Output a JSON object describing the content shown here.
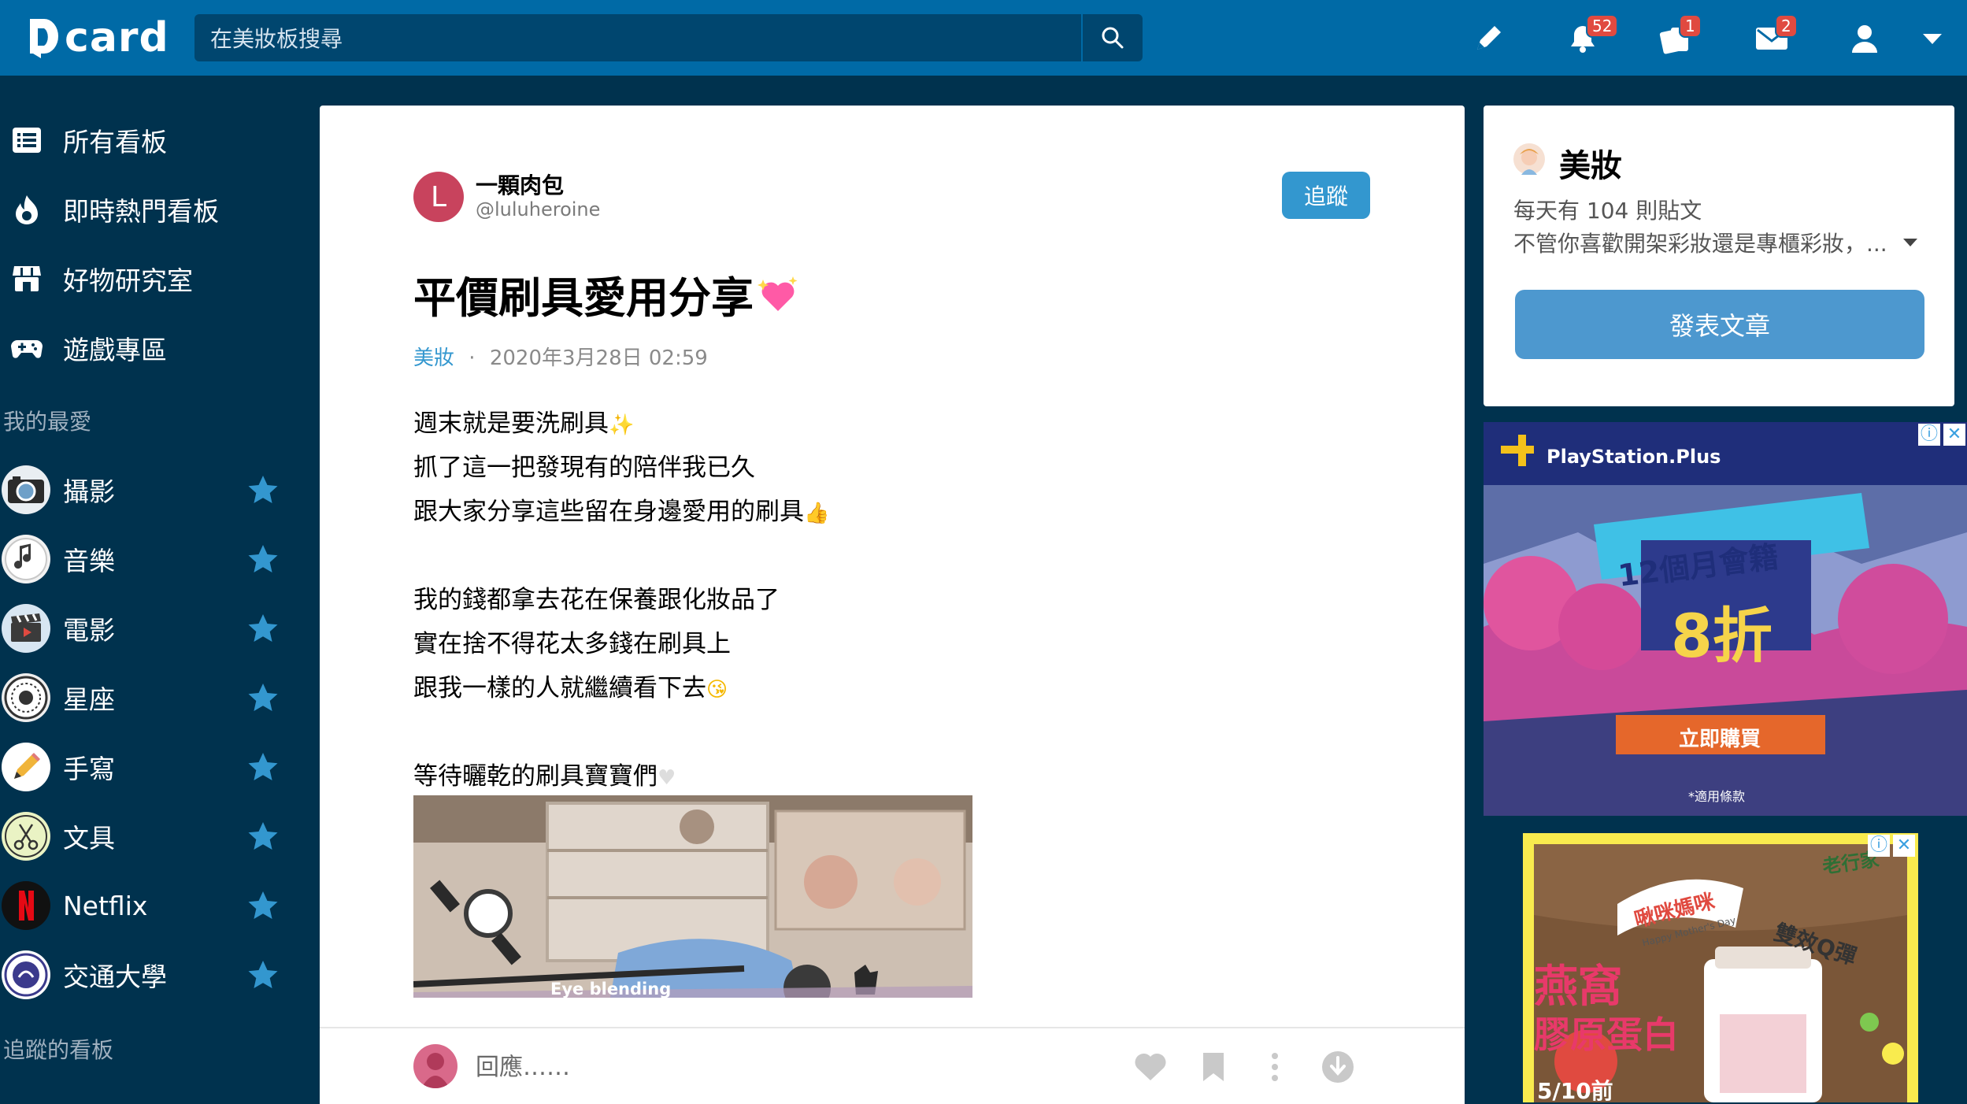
{
  "app": {
    "logo_text": "card"
  },
  "search": {
    "placeholder": "在美妝板搜尋"
  },
  "nav": {
    "notifications_count": "52",
    "cards_count": "1",
    "messages_count": "2"
  },
  "sidebar": {
    "main_items": [
      {
        "label": "所有看板",
        "icon": "list-icon"
      },
      {
        "label": "即時熱門看板",
        "icon": "flame-icon"
      },
      {
        "label": "好物研究室",
        "icon": "store-icon"
      },
      {
        "label": "遊戲專區",
        "icon": "gamepad-icon"
      }
    ],
    "favorites_heading": "我的最愛",
    "favorites": [
      {
        "label": "攝影",
        "icon": "camera-icon"
      },
      {
        "label": "音樂",
        "icon": "music-icon"
      },
      {
        "label": "電影",
        "icon": "clapperboard-icon"
      },
      {
        "label": "星座",
        "icon": "zodiac-icon"
      },
      {
        "label": "手寫",
        "icon": "pencil-icon"
      },
      {
        "label": "文具",
        "icon": "scissors-icon"
      },
      {
        "label": "Netflix",
        "icon": "netflix-icon"
      },
      {
        "label": "交通大學",
        "icon": "university-icon"
      }
    ],
    "following_heading": "追蹤的看板"
  },
  "post": {
    "author": {
      "initial": "L",
      "name": "一顆肉包",
      "handle": "@luluheroine"
    },
    "follow_label": "追蹤",
    "title": "平價刷具愛用分享",
    "forum": "美妝",
    "separator": "·",
    "datetime": "2020年3月28日 02:59",
    "body": [
      "週末就是要洗刷具",
      "抓了這一把發現有的陪伴我已久",
      "跟大家分享這些留在身邊愛用的刷具",
      "我的錢都拿去花在保養跟化妝品了",
      "實在捨不得花太多錢在刷具上",
      "跟我一樣的人就繼續看下去",
      "等待曬乾的刷具寶寶們"
    ],
    "image_caption": "Eye blending",
    "reply_placeholder": "回應……"
  },
  "forum_card": {
    "name": "美妝",
    "stat": "每天有 104 則貼文",
    "description": "不管你喜歡開架彩妝還是專櫃彩妝，...",
    "post_button": "發表文章"
  },
  "ads": {
    "ad1": {
      "brand": "PlayStation.Plus",
      "headline": "12個月會籍",
      "discount": "8折",
      "cta": "立即購買",
      "note": "*適用條款"
    },
    "ad2": {
      "brand": "老行家",
      "ribbon": "啾咪媽咪",
      "ribbon_sub": "Happy Mother's Day",
      "tagline": "雙效Q彈",
      "product_line1": "燕窩",
      "product_line2": "膠原蛋白",
      "promo": "5/10前"
    }
  },
  "colors": {
    "topbar": "#006aa6",
    "sidebar": "#00324e",
    "accent": "#3397cf",
    "badge": "#e04a40",
    "star": "#3397cf"
  }
}
